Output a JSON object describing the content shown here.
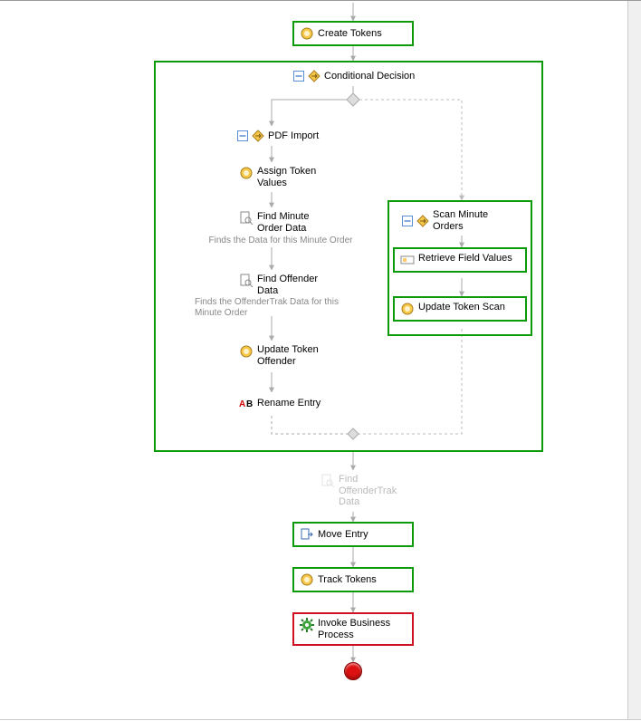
{
  "nodes": {
    "create_tokens": "Create Tokens",
    "conditional_decision": "Conditional Decision",
    "pdf_import": "PDF Import",
    "assign_token_values": "Assign Token Values",
    "find_minute_order_data": "Find Minute Order Data",
    "find_minute_order_data_sub": "Finds the Data for this Minute Order",
    "find_offender_data": "Find Offender Data",
    "find_offender_data_sub": "Finds the OffenderTrak Data for this Minute Order",
    "update_token_offender": "Update Token Offender",
    "rename_entry": "Rename Entry",
    "scan_minute_orders": "Scan Minute Orders",
    "retrieve_field_values": "Retrieve Field Values",
    "update_token_scan": "Update Token Scan",
    "find_offendertrak_data": "Find OffenderTrak Data",
    "move_entry": "Move Entry",
    "track_tokens": "Track Tokens",
    "invoke_business_process": "Invoke Business Process"
  },
  "icons": {
    "token": "token-coin",
    "collapse": "minus-box",
    "branch": "diamond-arrow",
    "find": "search-doc",
    "retrieve": "field-box",
    "rename": "rename-ab",
    "move": "move-doc",
    "gear": "gear-green",
    "end": "stop-circle"
  }
}
